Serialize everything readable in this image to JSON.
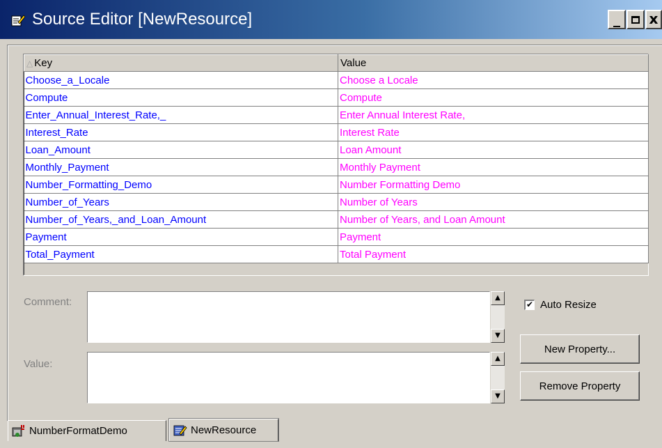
{
  "window": {
    "title": "Source Editor [NewResource]",
    "buttons": {
      "minimize": "_",
      "maximize": "□",
      "close": "x"
    }
  },
  "table": {
    "columns": [
      "Key",
      "Value"
    ],
    "rows": [
      {
        "key": "Choose_a_Locale",
        "value": "Choose a Locale"
      },
      {
        "key": "Compute",
        "value": "Compute"
      },
      {
        "key": "Enter_Annual_Interest_Rate,_",
        "value": "Enter Annual Interest Rate,"
      },
      {
        "key": "Interest_Rate",
        "value": "Interest Rate"
      },
      {
        "key": "Loan_Amount",
        "value": "Loan Amount"
      },
      {
        "key": "Monthly_Payment",
        "value": "Monthly Payment"
      },
      {
        "key": "Number_Formatting_Demo",
        "value": "Number Formatting Demo"
      },
      {
        "key": "Number_of_Years",
        "value": "Number of Years"
      },
      {
        "key": "Number_of_Years,_and_Loan_Amount",
        "value": "Number of Years, and Loan Amount"
      },
      {
        "key": "Payment",
        "value": "Payment"
      },
      {
        "key": "Total_Payment",
        "value": "Total Payment"
      }
    ],
    "colors": {
      "key_text": "#0000ff",
      "value_text": "#ff00ff"
    }
  },
  "editor": {
    "comment_label": "Comment:",
    "comment_value": "",
    "value_label": "Value:",
    "value_value": ""
  },
  "options": {
    "auto_resize_label": "Auto Resize",
    "auto_resize_checked": true,
    "new_property_label": "New Property...",
    "remove_property_label": "Remove Property"
  },
  "tabs": [
    {
      "label": "NumberFormatDemo",
      "icon": "form-icon",
      "active": false
    },
    {
      "label": "NewResource",
      "icon": "resource-icon",
      "active": true
    }
  ]
}
